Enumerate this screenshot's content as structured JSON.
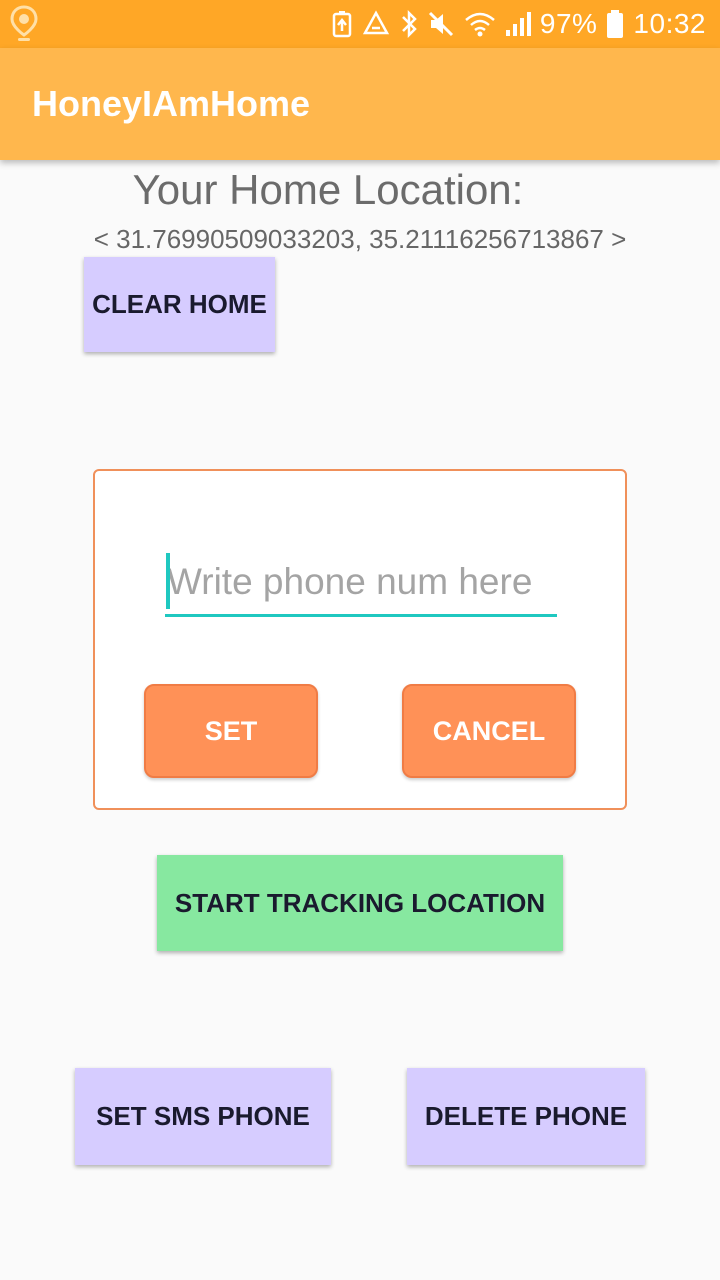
{
  "status_bar": {
    "left_icons": [
      "location-pin-icon"
    ],
    "right_icons": [
      "battery-saver-icon",
      "recycle-icon",
      "bluetooth-icon",
      "mute-icon",
      "wifi-icon",
      "signal-icon"
    ],
    "battery_percent": "97%",
    "time": "10:32",
    "colors": {
      "background": "#ffa726",
      "foreground": "#ffffff"
    }
  },
  "app_bar": {
    "title": "HoneyIAmHome",
    "color": "#ffb74d"
  },
  "home": {
    "heading": "Your Home Location:",
    "coordinates": "< 31.76990509033203, 35.21116256713867 >",
    "clear_label": "CLEAR HOME"
  },
  "dialog": {
    "phone_placeholder": "Write phone num here",
    "phone_value": "",
    "set_label": "SET",
    "cancel_label": "CANCEL",
    "accent": "#1fc8c0",
    "button_color": "#ff9157"
  },
  "tracking": {
    "start_label": "START TRACKING LOCATION"
  },
  "sms": {
    "set_label": "SET SMS PHONE",
    "delete_label": "DELETE PHONE"
  }
}
